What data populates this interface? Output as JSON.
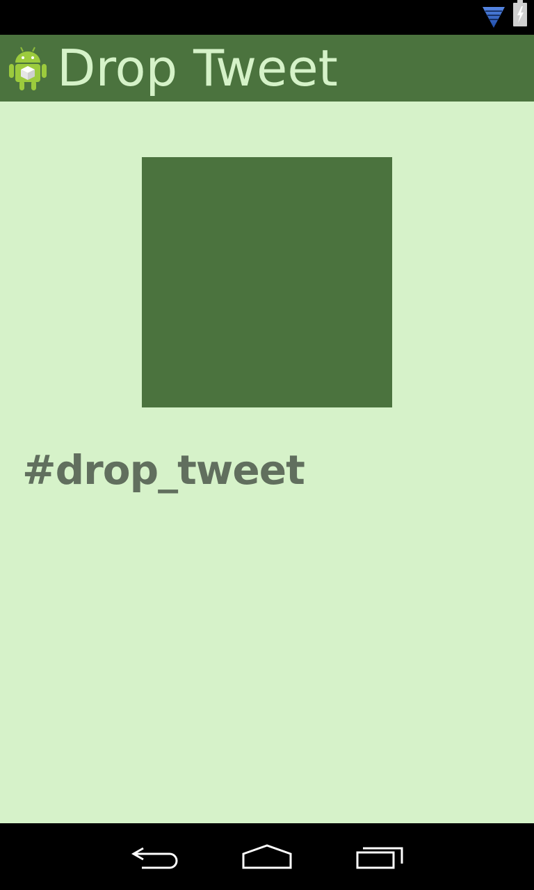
{
  "app": {
    "title": "Drop Tweet",
    "icon": "android-robot-icon"
  },
  "status_bar": {
    "icons": [
      "wifi-icon",
      "battery-charging-icon"
    ]
  },
  "content": {
    "hashtag": "#drop_tweet"
  },
  "nav_bar": {
    "buttons": [
      "back-icon",
      "home-icon",
      "recents-icon"
    ]
  },
  "colors": {
    "action_bar": "#4b733e",
    "background": "#d6f2c9",
    "title_text": "#d5f2c8",
    "hashtag_text": "#616f5e",
    "drop_target": "#4b733e",
    "wifi": "#3a6fd6"
  }
}
